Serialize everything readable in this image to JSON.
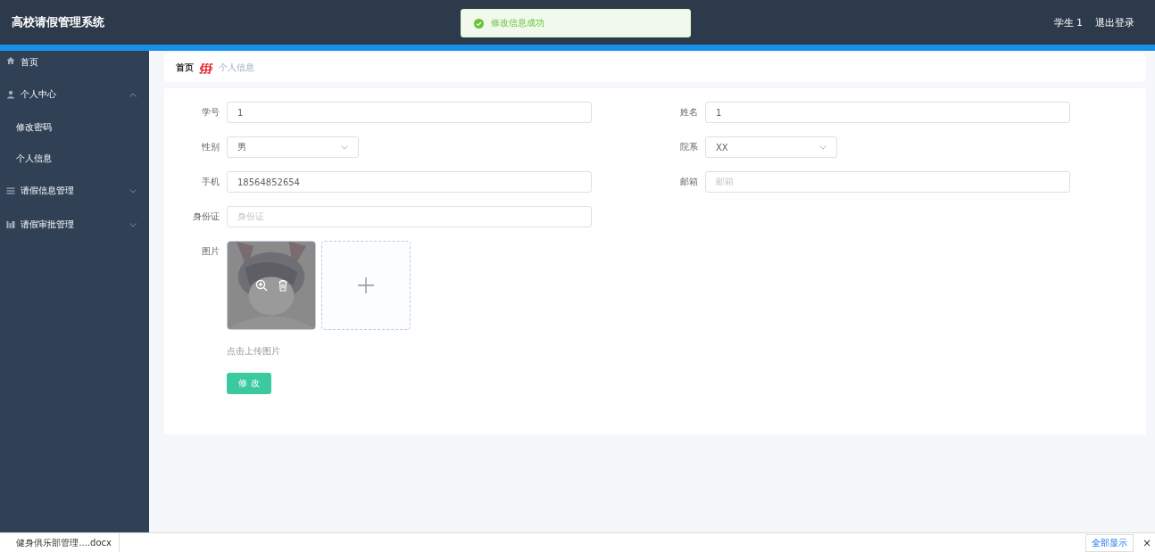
{
  "header": {
    "title": "高校请假管理系统",
    "user": "学生 1",
    "logout": "退出登录"
  },
  "toast": {
    "kind": "success",
    "text": "修改信息成功"
  },
  "sidebar": {
    "items": [
      {
        "label": "首页"
      },
      {
        "label": "个人中心",
        "expanded": true,
        "children": [
          {
            "label": "修改密码"
          },
          {
            "label": "个人信息"
          }
        ]
      },
      {
        "label": "请假信息管理",
        "expanded": false
      },
      {
        "label": "请假审批管理",
        "expanded": false
      }
    ]
  },
  "breadcrumb": {
    "home": "首页",
    "separator": "∰",
    "current": "个人信息"
  },
  "form": {
    "rows": [
      [
        {
          "label": "学号",
          "kind": "input",
          "value": "1"
        },
        {
          "label": "姓名",
          "kind": "input",
          "value": "1"
        }
      ],
      [
        {
          "label": "性别",
          "kind": "select",
          "value": "男"
        },
        {
          "label": "院系",
          "kind": "select",
          "value": "XX"
        }
      ],
      [
        {
          "label": "手机",
          "kind": "input",
          "value": "18564852654"
        },
        {
          "label": "邮箱",
          "kind": "input",
          "placeholder": "邮箱"
        }
      ],
      [
        {
          "label": "身份证",
          "kind": "input",
          "placeholder": "身份证"
        }
      ]
    ],
    "image_label": "图片",
    "upload_hint": "点击上传图片",
    "submit": "修 改"
  },
  "download_bar": {
    "file": "健身俱乐部管理....docx",
    "show_all": "全部显示",
    "close": "×"
  }
}
